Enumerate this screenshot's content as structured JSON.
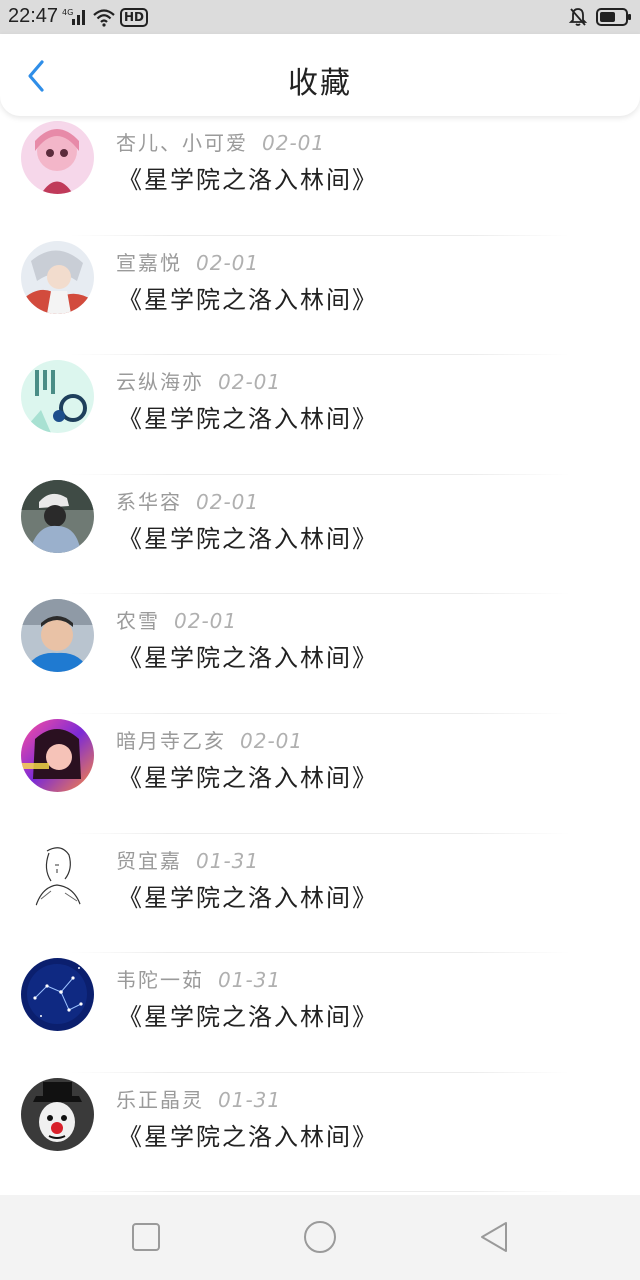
{
  "status": {
    "time": "22:47",
    "network": "4G",
    "hd": "HD"
  },
  "header": {
    "title": "收藏"
  },
  "items": [
    {
      "name": "杏儿、小可爱",
      "date": "02-01",
      "book": "《星学院之洛入林间》"
    },
    {
      "name": "宣嘉悦",
      "date": "02-01",
      "book": "《星学院之洛入林间》"
    },
    {
      "name": "云纵海亦",
      "date": "02-01",
      "book": "《星学院之洛入林间》"
    },
    {
      "name": "系华容",
      "date": "02-01",
      "book": "《星学院之洛入林间》"
    },
    {
      "name": "农雪",
      "date": "02-01",
      "book": "《星学院之洛入林间》"
    },
    {
      "name": "暗月寺乙亥",
      "date": "02-01",
      "book": "《星学院之洛入林间》"
    },
    {
      "name": "贸宜嘉",
      "date": "01-31",
      "book": "《星学院之洛入林间》"
    },
    {
      "name": "韦陀一茹",
      "date": "01-31",
      "book": "《星学院之洛入林间》"
    },
    {
      "name": "乐正晶灵",
      "date": "01-31",
      "book": "《星学院之洛入林间》"
    }
  ],
  "colors": {
    "accent": "#2f8ee8",
    "status_bar": "#dcdcdc",
    "nav_bar": "#f3f3f3"
  },
  "icons": {
    "back": "chevron-left-icon",
    "nav_recent": "square-icon",
    "nav_home": "circle-icon",
    "nav_back": "triangle-back-icon"
  }
}
